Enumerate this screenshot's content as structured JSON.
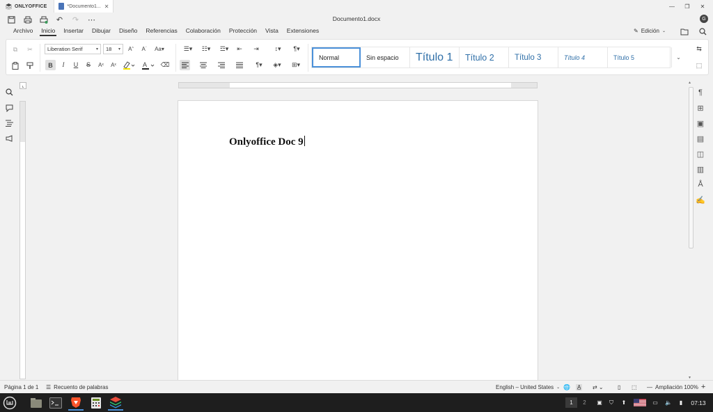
{
  "app": {
    "brand": "ONLYOFFICE",
    "tab_title": "*Documento1...",
    "doc_title": "Documento1.docx",
    "avatar_initial": "G"
  },
  "menu": {
    "tabs": [
      "Archivo",
      "Inicio",
      "Insertar",
      "Dibujar",
      "Diseño",
      "Referencias",
      "Colaboración",
      "Protección",
      "Vista",
      "Extensiones"
    ],
    "active": "Inicio",
    "edit_mode": "Edición"
  },
  "ribbon": {
    "font_name": "Liberation Serif",
    "font_size": "18",
    "styles": [
      "Normal",
      "Sin espacio",
      "Título 1",
      "Título 2",
      "Título 3",
      "Título 4",
      "Título 5"
    ],
    "selected_style": "Normal",
    "style_colors": {
      "heading": "#2f6fa8"
    }
  },
  "document": {
    "text": "Onlyoffice Doc 9"
  },
  "status": {
    "page": "Página 1 de 1",
    "word_count": "Recuento de palabras",
    "language": "English – United States",
    "zoom": "Ampliación 100%"
  },
  "taskbar": {
    "workspaces": [
      "1",
      "2"
    ],
    "clock": "07:13"
  }
}
